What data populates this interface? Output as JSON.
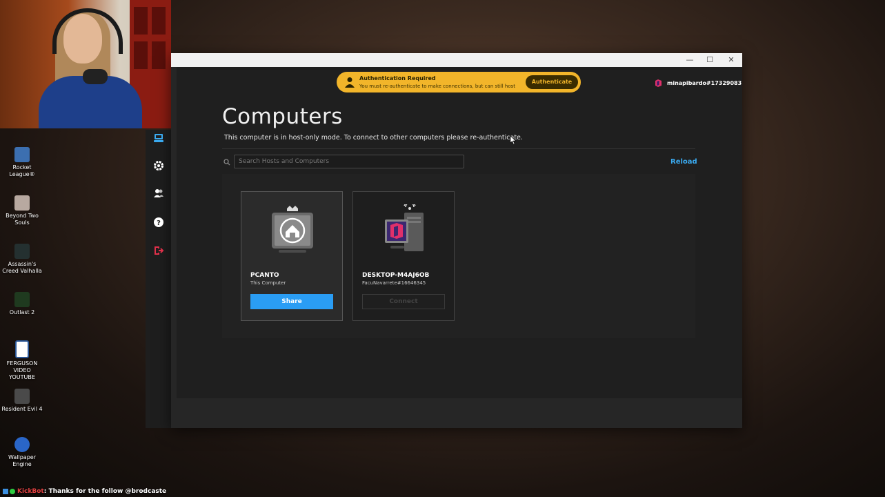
{
  "desktop": {
    "icons": [
      {
        "label": "Rocket League®",
        "icon": "rocket-league-icon"
      },
      {
        "label": "Beyond Two Souls",
        "icon": "beyond-two-souls-icon"
      },
      {
        "label": "Assassin's Creed Valhalla",
        "icon": "assassins-creed-icon"
      },
      {
        "label": "Outlast 2",
        "icon": "outlast-icon"
      },
      {
        "label": "FERGUSON VIDEO YOUTUBE",
        "icon": "word-document-icon"
      },
      {
        "label": "Resident Evil 4",
        "icon": "resident-evil-icon"
      },
      {
        "label": "Wallpaper Engine",
        "icon": "wallpaper-engine-icon"
      }
    ]
  },
  "chat": {
    "bot": "KickBot",
    "message": ": Thanks for the follow @brodcaste"
  },
  "window": {
    "controls": {
      "minimize": "—",
      "maximize": "☐",
      "close": "✕"
    }
  },
  "auth_banner": {
    "title": "Authentication Required",
    "message": "You must re-authenticate to make connections, but can still host",
    "button": "Authenticate",
    "color": "#f2b52a"
  },
  "user": {
    "name": "minapibardo#17329083"
  },
  "sidebar": {
    "items": [
      {
        "icon": "computer-icon",
        "active": true
      },
      {
        "icon": "gear-icon"
      },
      {
        "icon": "users-icon"
      },
      {
        "icon": "help-icon"
      },
      {
        "icon": "logout-icon"
      }
    ]
  },
  "main": {
    "title": "Computers",
    "subtitle": "This computer is in host-only mode. To connect to other computers please re-authenticate.",
    "search_placeholder": "Search Hosts and Computers",
    "reload": "Reload",
    "accent": "#3aaaf0"
  },
  "computers": [
    {
      "name": "PCANTO",
      "meta": "This Computer",
      "action": "Share",
      "enabled": true
    },
    {
      "name": "DESKTOP-M4AJ6OB",
      "meta": "FacuNavarrete#16646345",
      "action": "Connect",
      "enabled": false
    }
  ]
}
